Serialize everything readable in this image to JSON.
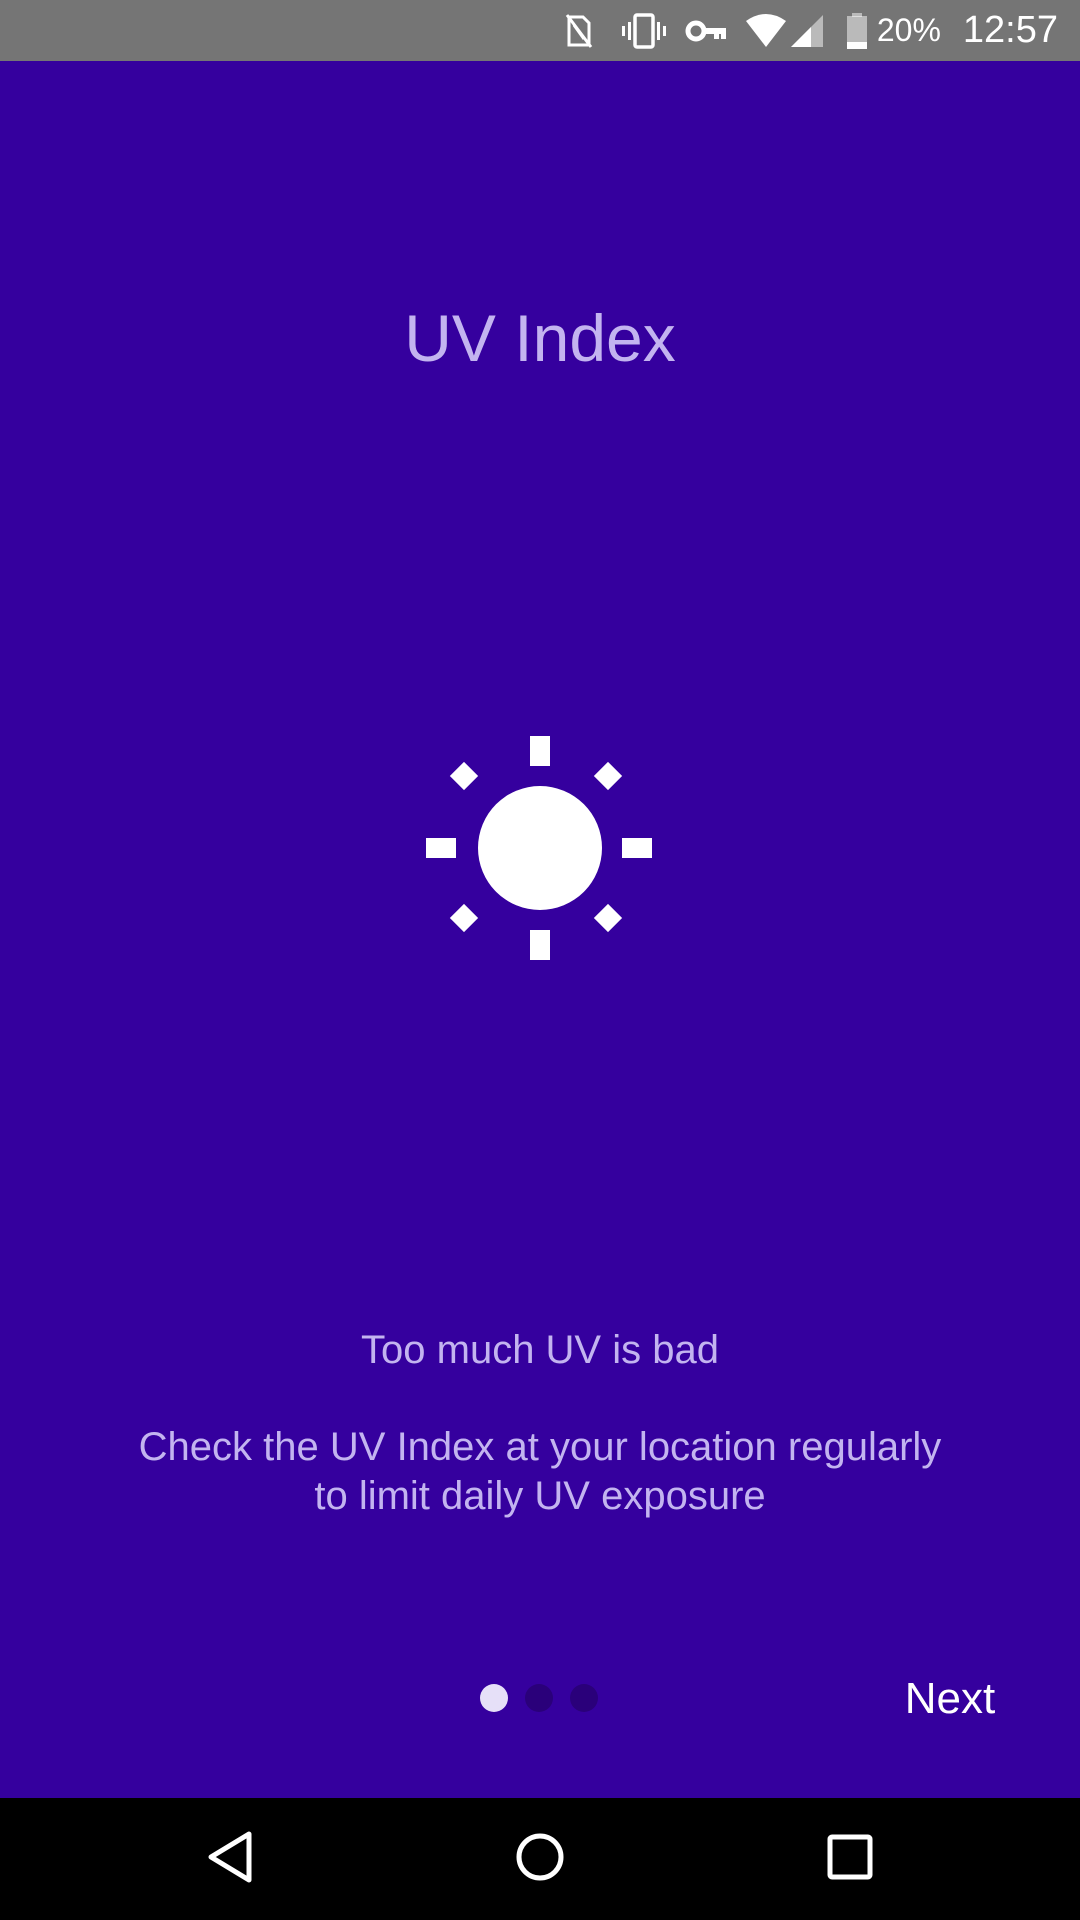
{
  "status_bar": {
    "icons": [
      "nfc-icon",
      "vibrate-icon",
      "vpn-key-icon",
      "wifi-icon",
      "signal-icon",
      "battery-icon"
    ],
    "battery_percent": "20%",
    "time": "12:57"
  },
  "onboarding": {
    "title": "UV Index",
    "illustration": "sun-icon",
    "heading": "Too much UV is bad",
    "body_line1": "Check the UV Index at your location regularly",
    "body_line2": "to limit daily UV exposure",
    "page_indicator": {
      "current": 1,
      "total": 3
    },
    "next_label": "Next"
  },
  "nav_bar": {
    "buttons": [
      "back-icon",
      "home-icon",
      "recents-icon"
    ]
  },
  "colors": {
    "background": "#35009e",
    "text_muted": "#c3b4f0",
    "status_bar": "#757575",
    "dot_active": "#e6e0f8",
    "dot_inactive": "#2a007a"
  }
}
